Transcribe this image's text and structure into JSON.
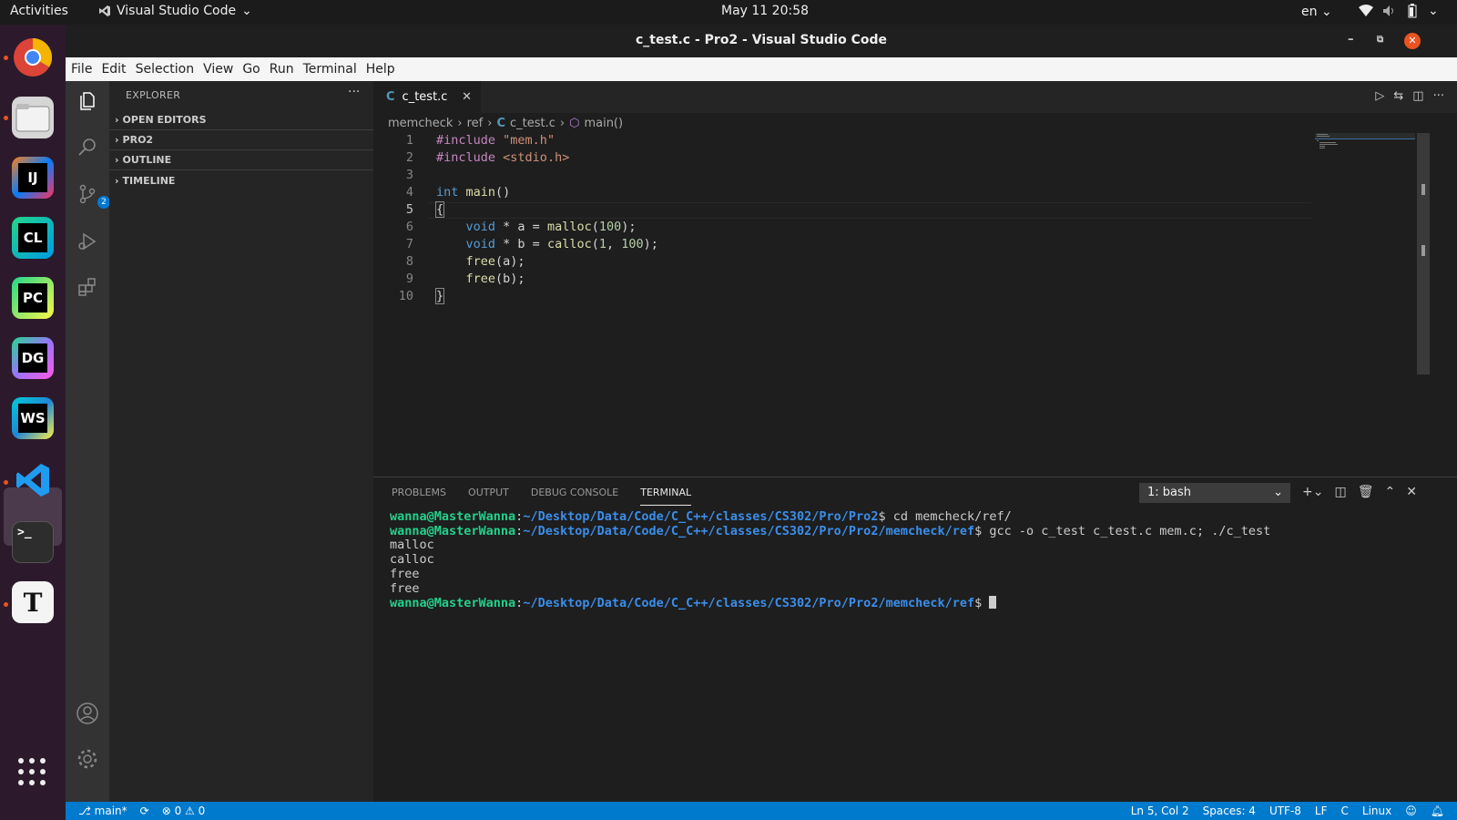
{
  "topbar": {
    "activities": "Activities",
    "app_name": "Visual Studio Code",
    "clock": "May 11  20:58",
    "lang": "en"
  },
  "window": {
    "title": "c_test.c - Pro2 - Visual Studio Code"
  },
  "menu": [
    "File",
    "Edit",
    "Selection",
    "View",
    "Go",
    "Run",
    "Terminal",
    "Help"
  ],
  "dock": [
    {
      "name": "chrome-icon",
      "label": ""
    },
    {
      "name": "files-icon",
      "label": ""
    },
    {
      "name": "intellij-icon",
      "label": "IJ"
    },
    {
      "name": "clion-icon",
      "label": "CL"
    },
    {
      "name": "pycharm-icon",
      "label": "PC"
    },
    {
      "name": "datagrip-icon",
      "label": "DG"
    },
    {
      "name": "webstorm-icon",
      "label": "WS"
    },
    {
      "name": "vscode-icon",
      "label": ""
    },
    {
      "name": "terminal-icon",
      "label": ">_"
    },
    {
      "name": "typora-icon",
      "label": "T"
    }
  ],
  "activity": {
    "scm_badge": "2"
  },
  "sidebar": {
    "header": "EXPLORER",
    "sections": [
      "OPEN EDITORS",
      "PRO2",
      "OUTLINE",
      "TIMELINE"
    ]
  },
  "editor": {
    "tab": "c_test.c",
    "breadcrumb": [
      "memcheck",
      "ref",
      "c_test.c",
      "main()"
    ],
    "line_numbers": [
      "1",
      "2",
      "3",
      "4",
      "5",
      "6",
      "7",
      "8",
      "9",
      "10"
    ],
    "current_line": "5"
  },
  "panel": {
    "tabs": [
      "PROBLEMS",
      "OUTPUT",
      "DEBUG CONSOLE",
      "TERMINAL"
    ],
    "active_tab": "TERMINAL",
    "shell": "1: bash",
    "terminal": [
      {
        "user": "wanna@MasterWanna",
        "path": "~/Desktop/Data/Code/C_C++/classes/CS302/Pro/Pro2",
        "cmd": "$ cd memcheck/ref/"
      },
      {
        "user": "wanna@MasterWanna",
        "path": "~/Desktop/Data/Code/C_C++/classes/CS302/Pro/Pro2/memcheck/ref",
        "cmd": "$ gcc -o c_test c_test.c mem.c; ./c_test"
      },
      {
        "text": "malloc"
      },
      {
        "text": "calloc"
      },
      {
        "text": "free"
      },
      {
        "text": "free"
      },
      {
        "user": "wanna@MasterWanna",
        "path": "~/Desktop/Data/Code/C_C++/classes/CS302/Pro/Pro2/memcheck/ref",
        "cmd": "$ ",
        "cursor": true
      }
    ]
  },
  "status": {
    "branch": "main*",
    "errors": "0",
    "warnings": "0",
    "position": "Ln 5, Col 2",
    "spaces": "Spaces: 4",
    "encoding": "UTF-8",
    "eol": "LF",
    "language": "C",
    "platform": "Linux"
  }
}
